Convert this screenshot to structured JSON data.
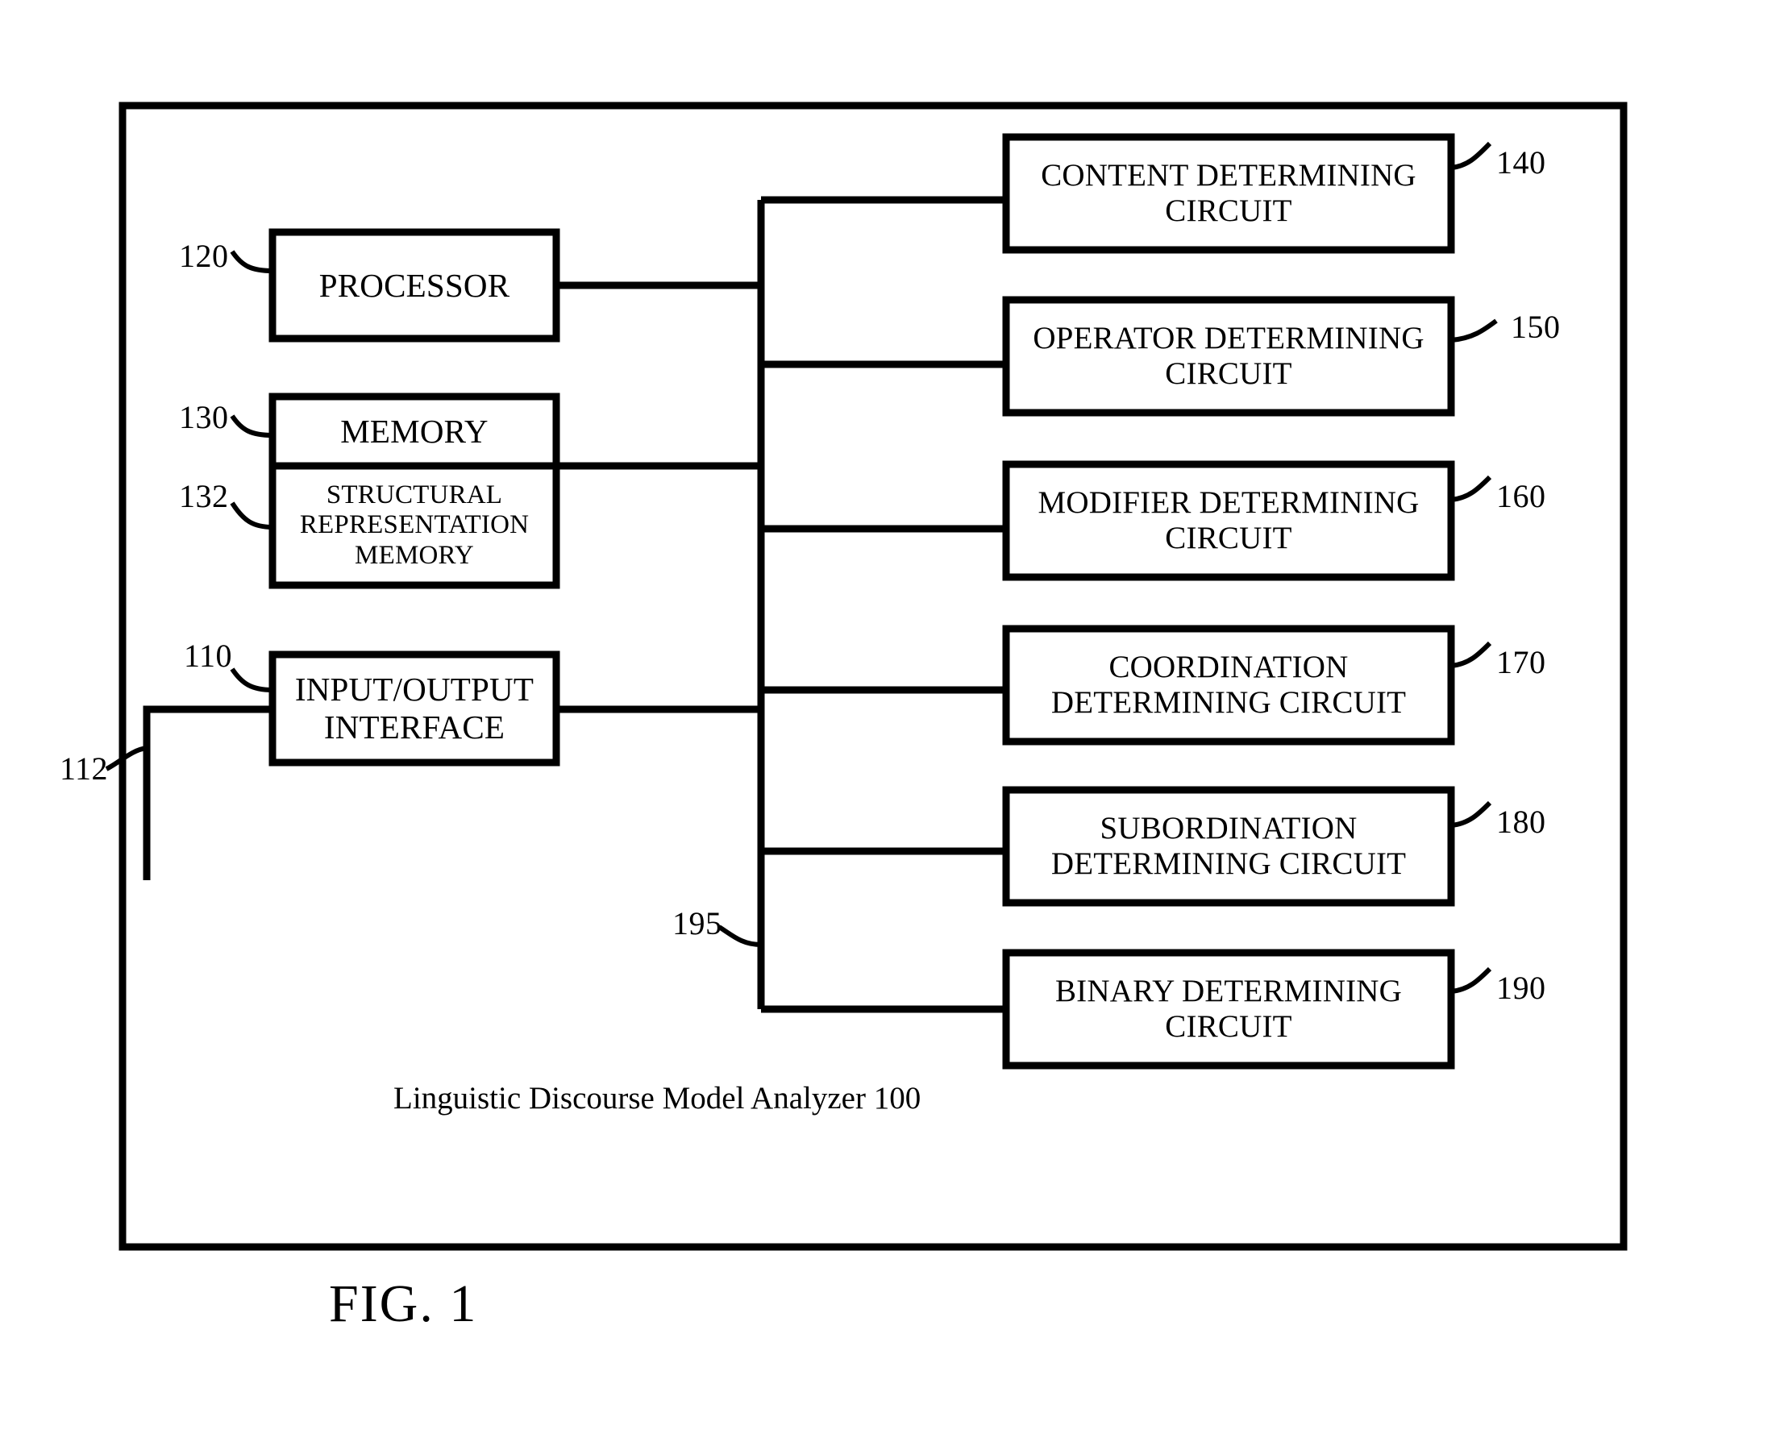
{
  "figure": {
    "title": "FIG. 1",
    "system_caption": "Linguistic Discourse Model Analyzer 100"
  },
  "left_blocks": [
    {
      "id": "processor",
      "label": "PROCESSOR",
      "ref": "120"
    },
    {
      "id": "memory",
      "label": "MEMORY",
      "ref": "130"
    },
    {
      "id": "srmemory",
      "label": "STRUCTURAL\nREPRESENTATION\nMEMORY",
      "ref": "132"
    },
    {
      "id": "ioiface",
      "label": "INPUT/OUTPUT\nINTERFACE",
      "ref": "110"
    }
  ],
  "right_blocks": [
    {
      "id": "content",
      "label": "CONTENT DETERMINING\nCIRCUIT",
      "ref": "140"
    },
    {
      "id": "operator",
      "label": "OPERATOR DETERMINING\nCIRCUIT",
      "ref": "150"
    },
    {
      "id": "modifier",
      "label": "MODIFIER DETERMINING\nCIRCUIT",
      "ref": "160"
    },
    {
      "id": "coordination",
      "label": "COORDINATION\nDETERMINING CIRCUIT",
      "ref": "170"
    },
    {
      "id": "subordination",
      "label": "SUBORDINATION\nDETERMINING CIRCUIT",
      "ref": "180"
    },
    {
      "id": "binary",
      "label": "BINARY DETERMINING\nCIRCUIT",
      "ref": "190"
    }
  ],
  "connections": [
    {
      "id": "external-link",
      "ref": "112"
    },
    {
      "id": "internal-bus",
      "ref": "195"
    }
  ],
  "colors": {
    "line": "#000000",
    "background": "#ffffff"
  }
}
